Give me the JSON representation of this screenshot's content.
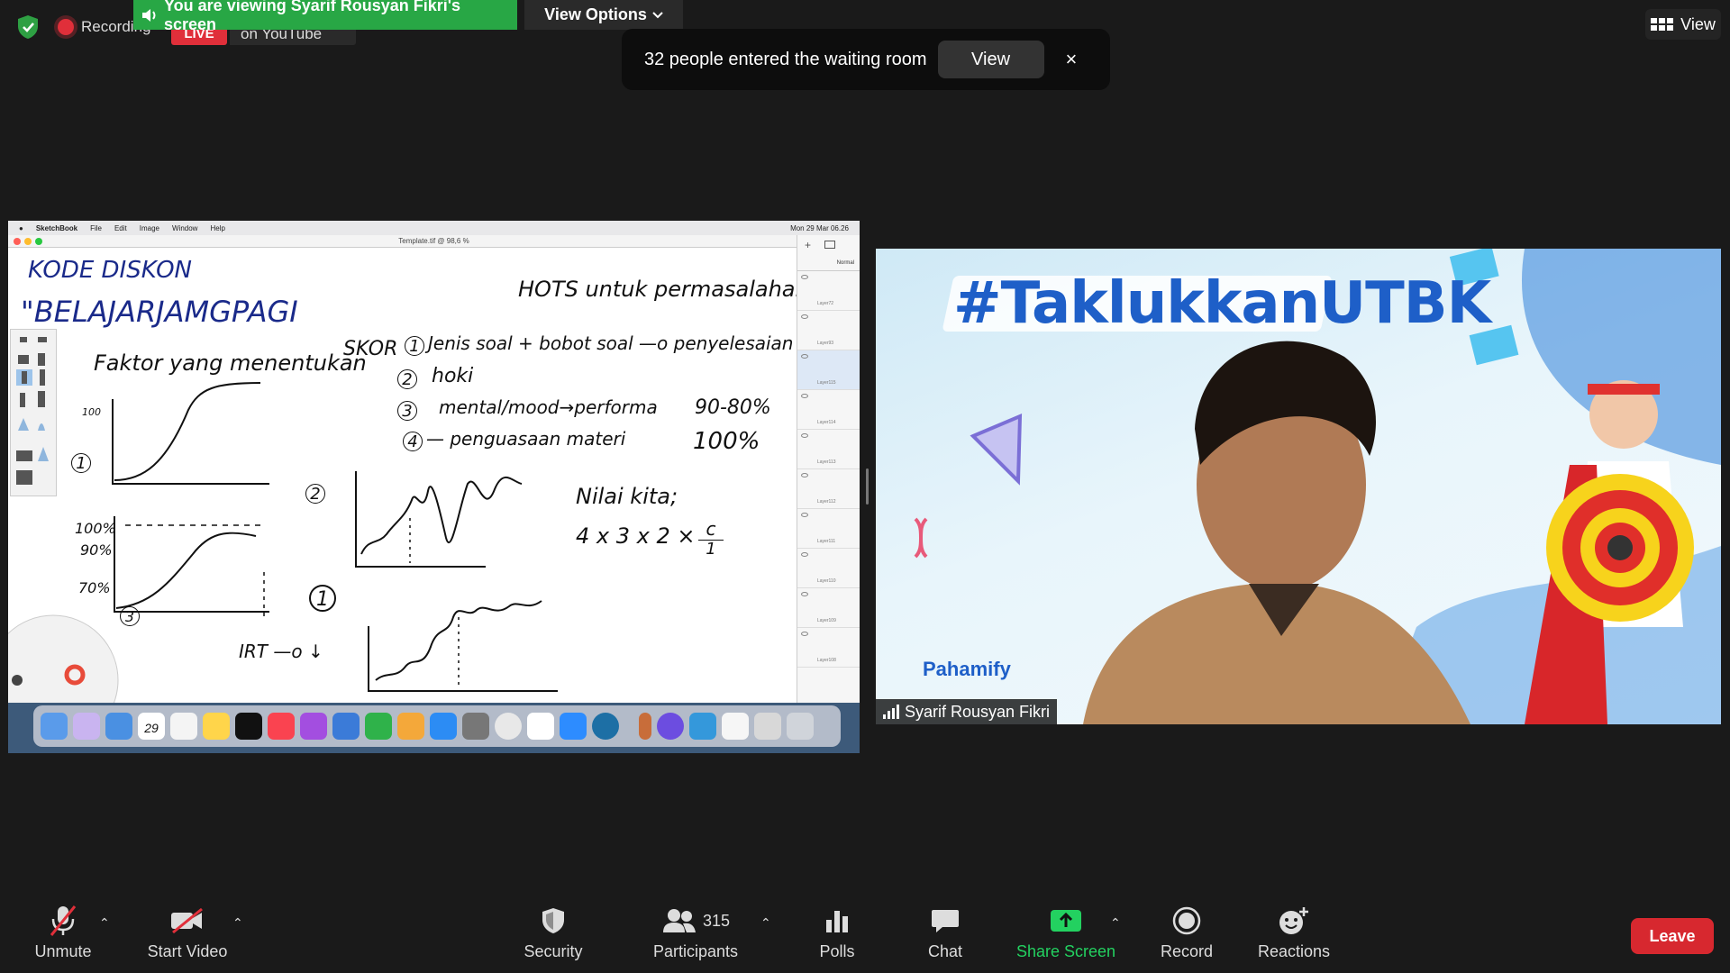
{
  "top": {
    "recording_label": "Recording",
    "live_label": "LIVE",
    "youtube_label": "on YouTube",
    "viewing_banner": "You are viewing Syarif Rousyan Fikri's screen",
    "view_options_label": "View Options",
    "view_label": "View"
  },
  "toast": {
    "message": "32 people entered the waiting room",
    "view_label": "View",
    "close_symbol": "×"
  },
  "shared_screen": {
    "menubar": [
      "SketchBook",
      "File",
      "Edit",
      "Image",
      "Window",
      "Help"
    ],
    "clock": "Mon 29 Mar  06.26",
    "window_title": "Template.tif @ 98,6 %",
    "blend_mode": "Normal",
    "layers": [
      "Layer72",
      "Layer93",
      "Layer115",
      "Layer114",
      "Layer113",
      "Layer112",
      "Layer111",
      "Layer110",
      "Layer109",
      "Layer108"
    ],
    "active_layer_index": 2,
    "dock_date": "29",
    "notes": {
      "kode": "KODE DISKON",
      "belajar": "\"BELAJARJAMGPAGI",
      "hots": "HOTS  untuk  permasalahan",
      "faktor": "Faktor   yang   menentukan",
      "skor": "SKOR",
      "item1_num": "1",
      "item1": "Jenis   soal  + bobot   soal  —o  penyelesaian",
      "item2_num": "2",
      "item2": "hoki",
      "item3_num": "3",
      "item3": "mental/mood→performa",
      "item4_num": "4",
      "item4": "— penguasaan    materi",
      "pct1": "90-80%",
      "pct2": "100%",
      "nilai": "Nilai  kita;",
      "formula": "4 x 3 x 2  ×",
      "frac_num": "c",
      "frac_den": "1",
      "g1_y": "100",
      "g1_label": "1",
      "g2_100": "100%",
      "g2_90": "90%",
      "g2_70": "70%",
      "g2_label": "3",
      "g3_label": "2",
      "g4_label": "1",
      "irt": "IRT —o ↓"
    }
  },
  "video": {
    "title": "#TaklukkanUTBK",
    "brand": "Pahamify",
    "participant_name": "Syarif Rousyan Fikri"
  },
  "toolbar": {
    "unmute": "Unmute",
    "start_video": "Start Video",
    "security": "Security",
    "participants": "Participants",
    "participants_count": "315",
    "polls": "Polls",
    "chat": "Chat",
    "share_screen": "Share Screen",
    "record": "Record",
    "reactions": "Reactions",
    "leave": "Leave"
  },
  "colors": {
    "share_green": "#23d160",
    "banner_green": "#28a745",
    "leave_red": "#d7282f",
    "record_red": "#e02f3a"
  }
}
